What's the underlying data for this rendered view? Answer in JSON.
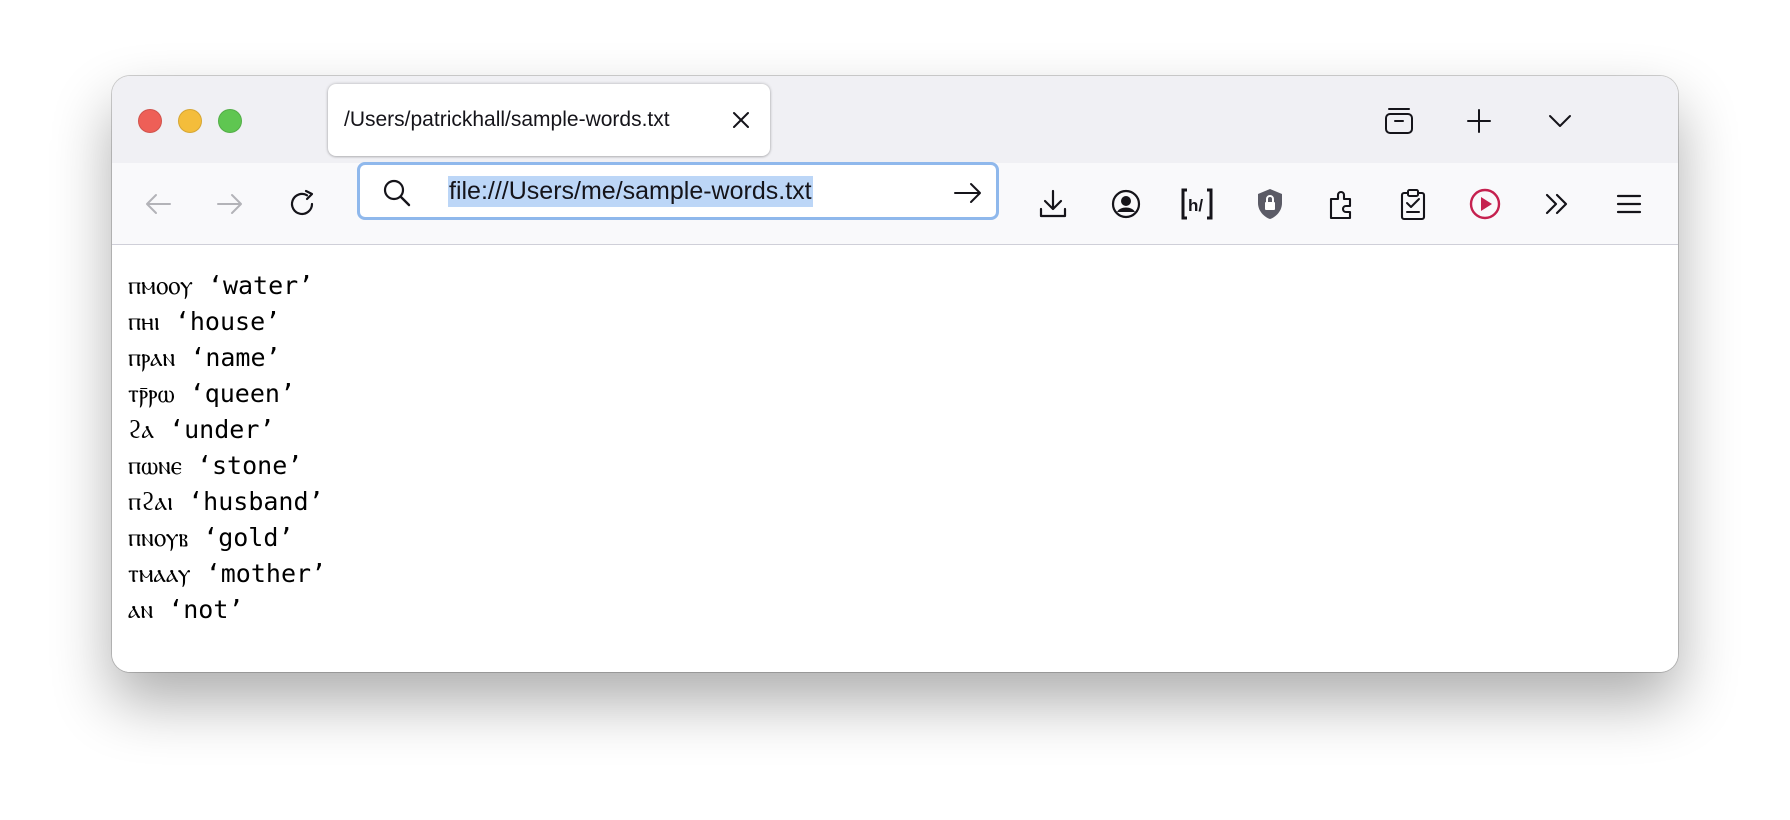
{
  "tab": {
    "title": "/Users/patrickhall/sample-words.txt"
  },
  "url_bar": {
    "value": "file:///Users/me/sample-words.txt"
  },
  "colors": {
    "tab_bar_bg": "#f0f0f4",
    "toolbar_bg": "#f9f9fb",
    "url_focus_border": "#8fb8ec",
    "url_selection": "#bcd6f7",
    "record_icon": "#c5214f"
  },
  "toolbar_icons": [
    "back-arrow-icon",
    "forward-arrow-icon",
    "reload-icon",
    "search-icon",
    "go-arrow-icon",
    "download-icon",
    "account-icon",
    "hypothesis-extension-icon",
    "privacy-shield-icon",
    "extensions-puzzle-icon",
    "clipboard-icon",
    "record-icon",
    "overflow-chevrons-icon",
    "menu-icon"
  ],
  "content": {
    "lines": [
      "ⲡⲙⲟⲟⲩ ‘water’",
      "ⲡⲏⲓ ‘house’",
      "ⲡⲣⲁⲛ ‘name’",
      "ⲧⲣ̄ⲣⲱ ‘queen’",
      "ϩⲁ ‘under’",
      "ⲡⲱⲛⲉ ‘stone’",
      "ⲡϩⲁⲓ ‘husband’",
      "ⲡⲛⲟⲩⲃ ‘gold’",
      "ⲧⲙⲁⲁⲩ ‘mother’",
      "ⲁⲛ ‘not’"
    ]
  }
}
